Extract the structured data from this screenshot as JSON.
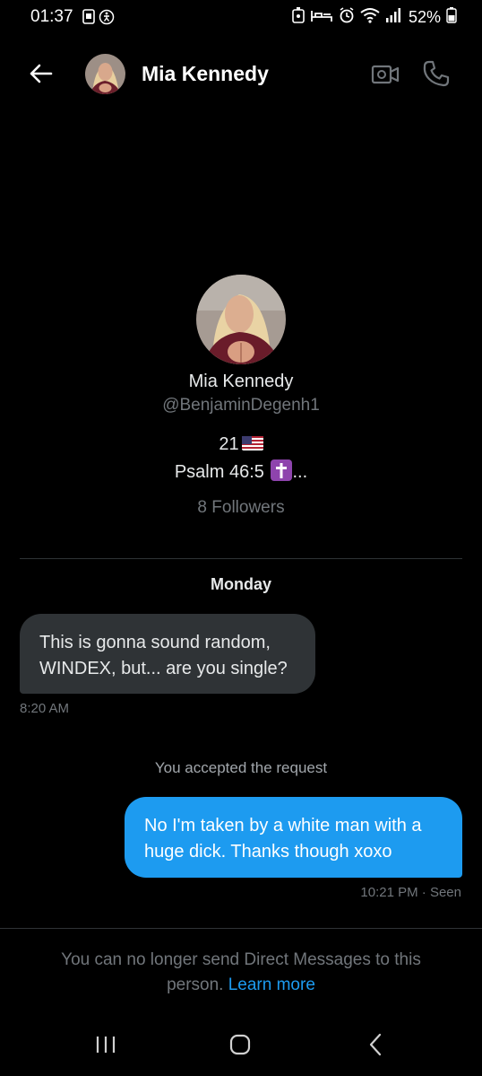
{
  "status_bar": {
    "time": "01:37",
    "battery": "52%",
    "icons": [
      "screenshot-icon",
      "accessibility-icon",
      "device-icon",
      "alarm-icon",
      "wifi-icon",
      "signal-icon",
      "battery-icon"
    ]
  },
  "header": {
    "name": "Mia Kennedy",
    "icons": [
      "back-arrow-icon",
      "video-call-icon",
      "phone-icon"
    ]
  },
  "profile": {
    "name": "Mia Kennedy",
    "handle": "@BenjaminDegenh1",
    "age": "21",
    "bio": "Psalm 46:5",
    "bio_suffix": "...",
    "followers": "8 Followers"
  },
  "conversation": {
    "day_label": "Monday",
    "incoming": {
      "text": "This is gonna sound random, WINDEX, but... are you single?",
      "time": "8:20 AM"
    },
    "system_message": "You accepted the request",
    "outgoing": {
      "text": "No I'm taken by a white man with a huge dick. Thanks though xoxo",
      "time": "10:21 PM · Seen"
    }
  },
  "footer": {
    "message": "You can no longer send Direct Messages to this person.",
    "link": "Learn more"
  },
  "colors": {
    "accent": "#1d9bf0",
    "incoming_bubble": "#2f3336",
    "muted_text": "#71767b"
  }
}
